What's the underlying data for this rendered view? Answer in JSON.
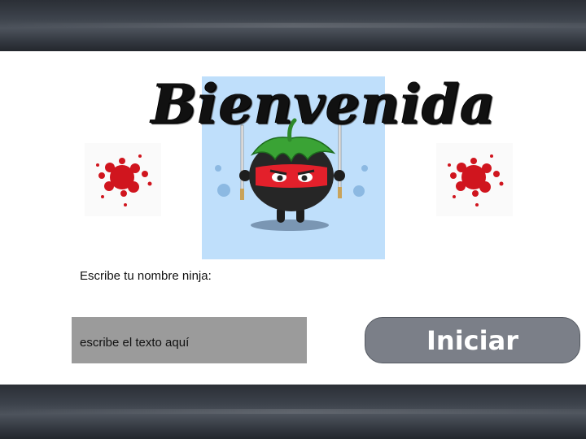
{
  "header": {
    "title": "Bienvenida"
  },
  "form": {
    "prompt_label": "Escribe tu nombre ninja:",
    "name_input": {
      "value": "",
      "placeholder": "escribe el texto aquí"
    },
    "start_button_label": "Iniciar"
  },
  "icons": {
    "hero": "tomato-ninja-icon",
    "left_decoration": "blood-splatter-icon",
    "right_decoration": "blood-splatter-icon"
  },
  "colors": {
    "band": "#3c424b",
    "button": "#7b7f88",
    "input": "#9b9b9b",
    "card": "#bfdffb",
    "splat": "#d0151e",
    "tomato_band": "#e3202b",
    "leaf": "#3aa335"
  }
}
